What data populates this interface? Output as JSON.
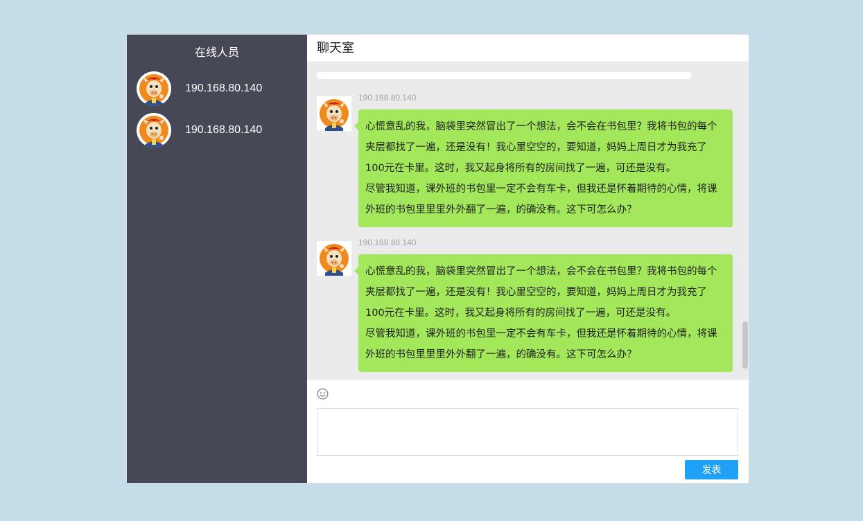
{
  "sidebar": {
    "title": "在线人员",
    "users": [
      {
        "name": "190.168.80.140"
      },
      {
        "name": "190.168.80.140"
      }
    ]
  },
  "chat": {
    "title": "聊天室",
    "messages": [
      {
        "sender": "190.168.80.140",
        "lines": [
          "心慌意乱的我，脑袋里突然冒出了一个想法，会不会在书包里？我将书包的每个夹层都找了一遍，还是没有！我心里空空的，要知道，妈妈上周日才为我充了100元在卡里。这时，我又起身将所有的房间找了一遍，可还是没有。",
          "尽管我知道，课外班的书包里一定不会有车卡，但我还是怀着期待的心情，将课外班的书包里里里外外翻了一遍，的确没有。这下可怎么办？"
        ]
      },
      {
        "sender": "190.168.80.140",
        "lines": [
          "心慌意乱的我，脑袋里突然冒出了一个想法，会不会在书包里？我将书包的每个夹层都找了一遍，还是没有！我心里空空的，要知道，妈妈上周日才为我充了100元在卡里。这时，我又起身将所有的房间找了一遍，可还是没有。",
          "尽管我知道，课外班的书包里一定不会有车卡，但我还是怀着期待的心情，将课外班的书包里里里外外翻了一遍，的确没有。这下可怎么办？"
        ]
      }
    ]
  },
  "composer": {
    "emoji_icon": "smiley-icon",
    "input_value": "",
    "send_label": "发表"
  },
  "colors": {
    "page_bg": "#c5dce9",
    "sidebar_bg": "#474856",
    "bubble_bg": "#a3e75b",
    "send_button": "#1ea1f7"
  }
}
